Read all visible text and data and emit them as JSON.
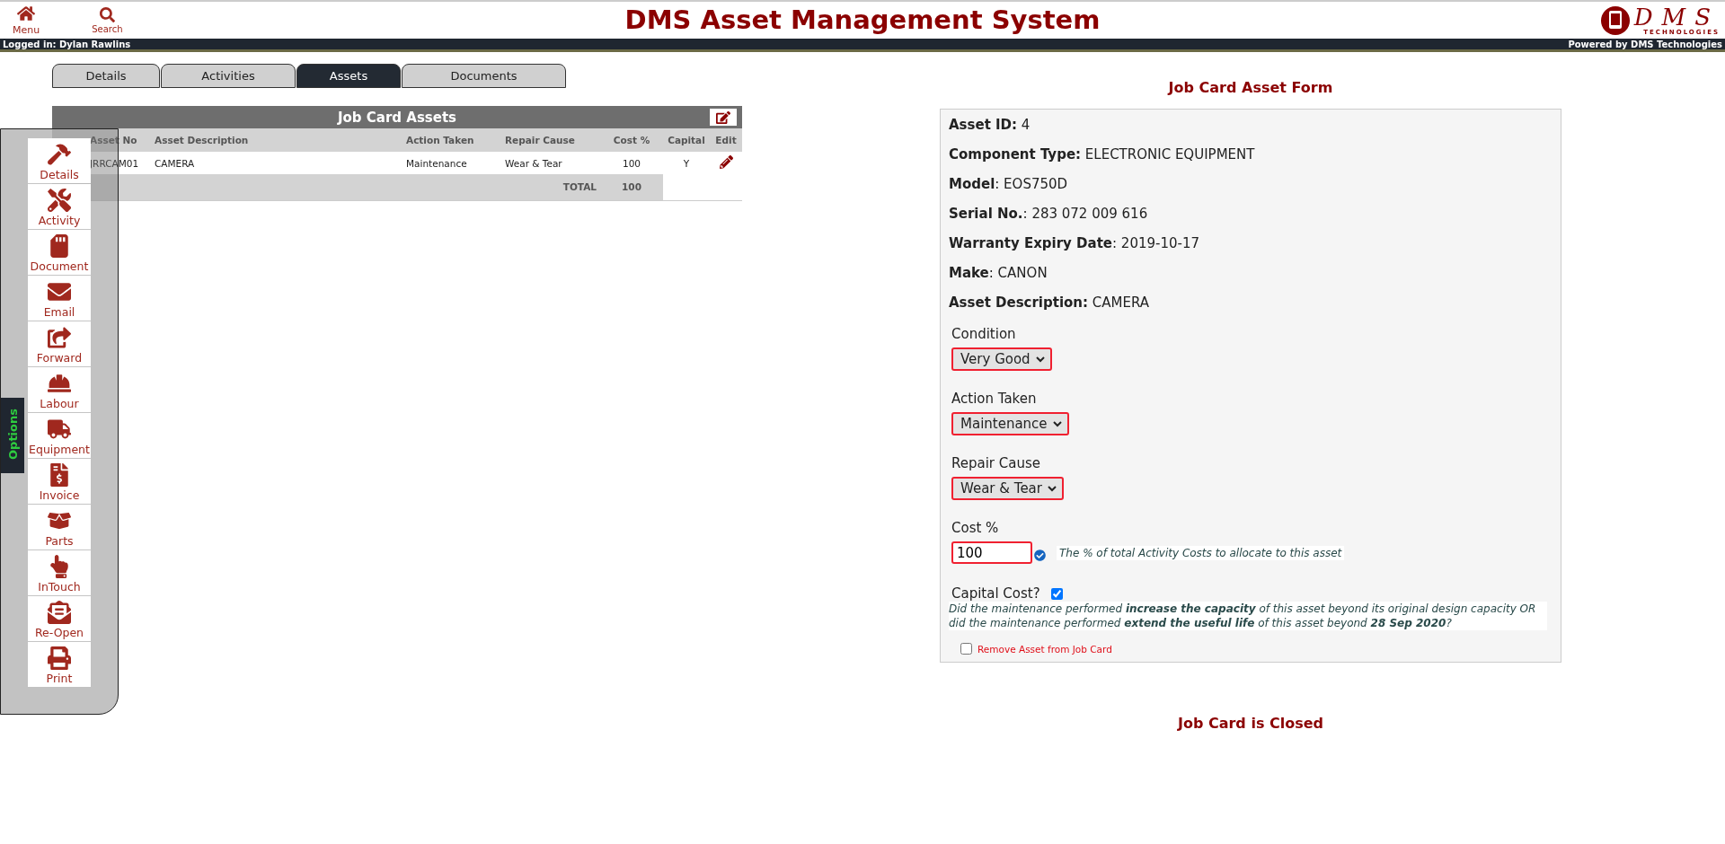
{
  "header": {
    "menu_button": "Menu",
    "search_button": "Search",
    "title": "DMS Asset Management System",
    "logo": {
      "letters": "DMS",
      "subtitle": "TECHNOLOGIES"
    }
  },
  "user_bar": {
    "logged_in": "Logged in: Dylan Rawlins",
    "powered_by": "Powered by DMS Technologies"
  },
  "tabs": [
    {
      "label": "Details",
      "selected": false
    },
    {
      "label": "Activities",
      "selected": false
    },
    {
      "label": "Assets",
      "selected": true
    },
    {
      "label": "Documents",
      "selected": false
    }
  ],
  "assets_table": {
    "title": "Job Card Assets",
    "columns": [
      "Asset No",
      "Asset Description",
      "Action Taken",
      "Repair Cause",
      "Cost %",
      "Capital",
      "Edit"
    ],
    "rows": [
      {
        "cells": [
          "JRRCAM01",
          "CAMERA",
          "Maintenance",
          "Wear & Tear",
          "100",
          "Y"
        ]
      }
    ],
    "total": {
      "label": "TOTAL",
      "value": "100"
    }
  },
  "options_panel": {
    "tab_label": "Options",
    "items": [
      {
        "kind": "details",
        "label": "Details"
      },
      {
        "kind": "activity",
        "label": "Activity"
      },
      {
        "kind": "document",
        "label": "Document"
      },
      {
        "kind": "email",
        "label": "Email"
      },
      {
        "kind": "forward",
        "label": "Forward"
      },
      {
        "kind": "labour",
        "label": "Labour"
      },
      {
        "kind": "equipment",
        "label": "Equipment"
      },
      {
        "kind": "invoice",
        "label": "Invoice"
      },
      {
        "kind": "parts",
        "label": "Parts"
      },
      {
        "kind": "intouch",
        "label": "InTouch"
      },
      {
        "kind": "reopen",
        "label": "Re-Open"
      },
      {
        "kind": "print",
        "label": "Print"
      }
    ]
  },
  "form": {
    "title": "Job Card Asset Form",
    "fields": [
      "**Asset ID:** 4",
      "**Component Type:** ELECTRONIC EQUIPMENT",
      "**Model**: EOS750D",
      "**Serial No.**: 283 072 009 616",
      "**Warranty Expiry Date**: 2019-10-17",
      "**Make**: CANON",
      "**Asset Description:** CAMERA"
    ],
    "selects": [
      {
        "label": "Condition",
        "value": "Very Good"
      },
      {
        "label": "Action Taken",
        "value": "Maintenance"
      },
      {
        "label": "Repair Cause",
        "value": "Wear & Tear"
      }
    ],
    "cost": {
      "label": "Cost %",
      "value": "100",
      "valid": true,
      "hint": "The % of total Activity Costs to allocate to this asset"
    },
    "capital": {
      "label": "Capital Cost?",
      "checked": true,
      "note": "Did the maintenance performed **increase the capacity** of this asset beyond its original design capacity OR did the maintenance performed **extend the useful life** of this asset beyond **28 Sep 2020**?"
    },
    "remove": {
      "label": "Remove Asset from Job Card",
      "checked": false
    }
  },
  "status": "Job Card is Closed"
}
